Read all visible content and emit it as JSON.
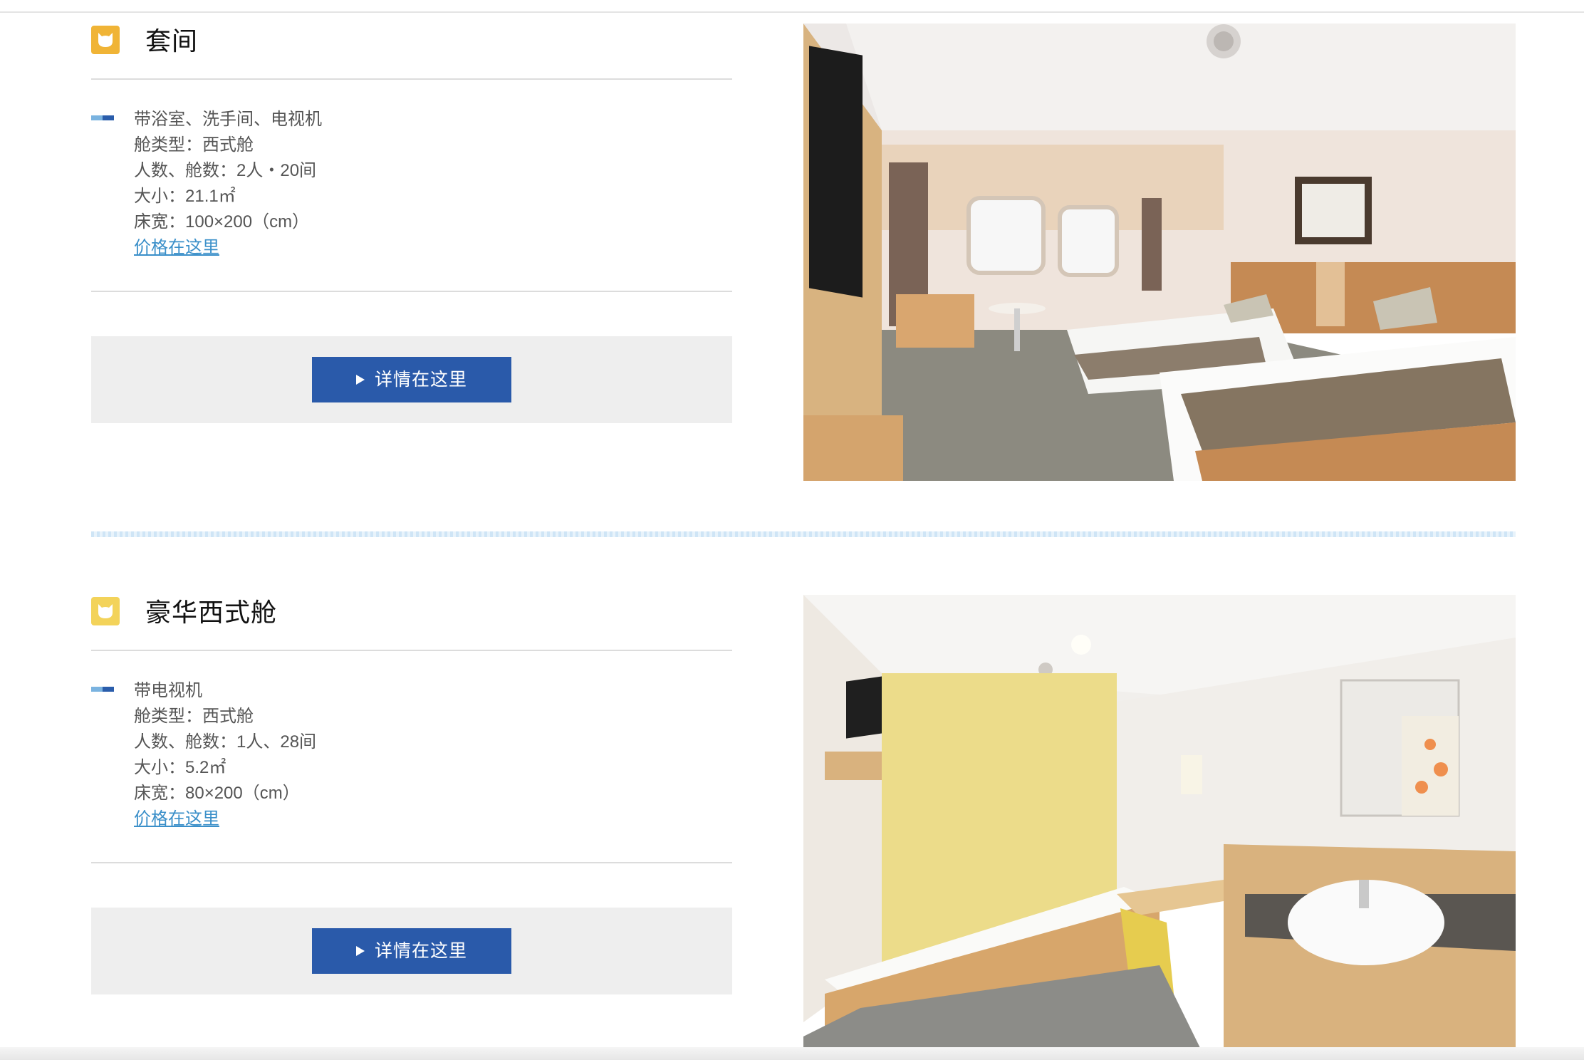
{
  "rooms": [
    {
      "title": "套间",
      "icon_color": "#f0b436",
      "lines": [
        "带浴室、洗手间、电视机",
        "舱类型：西式舱",
        "人数、舱数：2人・20间",
        "大小：21.1㎡",
        "床宽：100×200（cm）"
      ],
      "price_link": "价格在这里",
      "detail_button": "详情在这里",
      "photo": "twin-bed-suite-photo"
    },
    {
      "title": "豪华西式舱",
      "icon_color": "#f3d35a",
      "lines": [
        "带电视机",
        "舱类型：西式舱",
        "人数、舱数：1人、28间",
        "大小：5.2㎡",
        "床宽：80×200（cm）"
      ],
      "price_link": "价格在这里",
      "detail_button": "详情在这里",
      "photo": "single-bed-cabin-photo"
    }
  ],
  "colors": {
    "button_blue": "#2a5aaa",
    "link_blue": "#3a8fc9",
    "button_area_bg": "#eeeeee"
  }
}
